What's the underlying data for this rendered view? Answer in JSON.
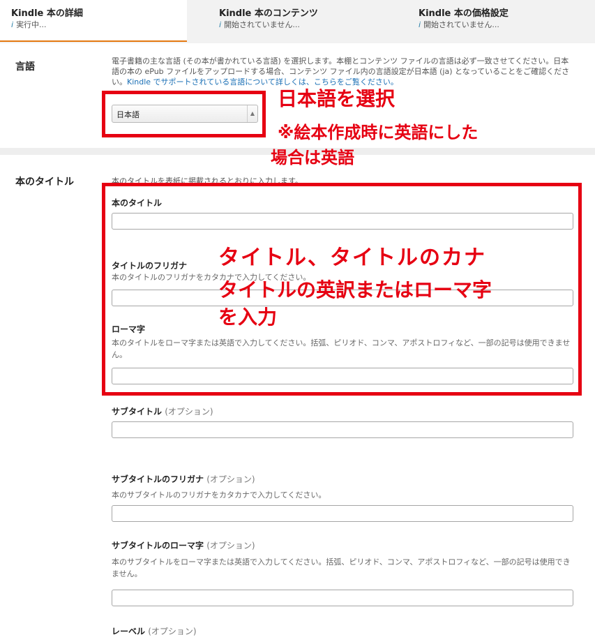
{
  "tabs": [
    {
      "title": "Kindle 本の詳細",
      "status": "実行中..."
    },
    {
      "title": "Kindle 本のコンテンツ",
      "status": "開始されていません..."
    },
    {
      "title": "Kindle 本の価格設定",
      "status": "開始されていません..."
    }
  ],
  "tab_status_icon": "i",
  "language": {
    "label": "言語",
    "desc_main": "電子書籍の主な言語 (その本が書かれている言語) を選択します。本棚とコンテンツ ファイルの言語は必ず一致させてください。日本語の本の ePub ファイルをアップロードする場合、コンテンツ ファイル内の言語設定が日本語 (ja) となっていることをご確認ください。",
    "desc_link": "Kindle でサポートされている言語について詳しくは、こちらをご覧ください。",
    "select_value": "日本語"
  },
  "title_section": {
    "label": "本のタイトル",
    "desc": "本のタイトルを表紙に掲載されるとおりに入力します。",
    "fields": {
      "title": {
        "label": "本のタイトル"
      },
      "furigana": {
        "label": "タイトルのフリガナ",
        "hint": "本のタイトルのフリガナをカタカナで入力してください。"
      },
      "romaji": {
        "label": "ローマ字",
        "hint": "本のタイトルをローマ字または英語で入力してください。括弧、ピリオド、コンマ、アポストロフィなど、一部の記号は使用できません。"
      },
      "subtitle": {
        "label": "サブタイトル",
        "optional": "(オプション)"
      },
      "subtitle_furigana": {
        "label": "サブタイトルのフリガナ",
        "optional": "(オプション)",
        "hint": "本のサブタイトルのフリガナをカタカナで入力してください。"
      },
      "subtitle_romaji": {
        "label": "サブタイトルのローマ字",
        "optional": "(オプション)",
        "hint": "本のサブタイトルをローマ字または英語で入力してください。括弧、ピリオド、コンマ、アポストロフィなど、一部の記号は使用できません。"
      },
      "label_field": {
        "label": "レーベル",
        "optional": "(オプション)"
      }
    }
  },
  "annotations": {
    "lang_line1": "日本語を選択",
    "lang_line2": "※絵本作成時に英語にした",
    "lang_line3": "場合は英語",
    "title_line1": "タイトル、タイトルのカナ",
    "title_line2": "タイトルの英訳またはローマ字",
    "title_line3": "を入力"
  },
  "colors": {
    "annotation_red": "#e60012",
    "active_tab_underline": "#e47911",
    "link": "#1a6fb5"
  }
}
